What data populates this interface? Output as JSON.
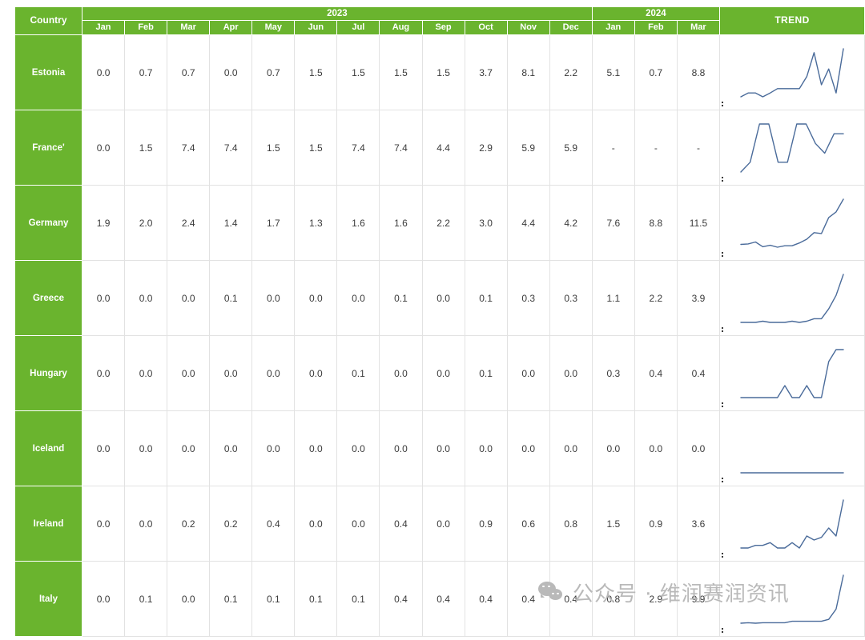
{
  "header": {
    "country_label": "Country",
    "trend_label": "TREND",
    "year_groups": [
      {
        "year": "2023",
        "months": [
          "Jan",
          "Feb",
          "Mar",
          "Apr",
          "May",
          "Jun",
          "Jul",
          "Aug",
          "Sep",
          "Oct",
          "Nov",
          "Dec"
        ]
      },
      {
        "year": "2024",
        "months": [
          "Jan",
          "Feb",
          "Mar"
        ]
      }
    ]
  },
  "colors": {
    "header_green": "#6ab42e",
    "grid_line": "#e2e2e2",
    "spark_line": "#4a6b9a",
    "value_text": "#3b3b3b",
    "watermark": "#b9b9b9"
  },
  "watermark": {
    "text": "公众号 · 维润赛润资讯",
    "logo": "wechat-logo"
  },
  "rows": [
    {
      "country": "Estonia",
      "values": [
        "0.0",
        "0.7",
        "0.7",
        "0.0",
        "0.7",
        "1.5",
        "1.5",
        "1.5",
        "1.5",
        "3.7",
        "8.1",
        "2.2",
        "5.1",
        "0.7",
        "8.8"
      ]
    },
    {
      "country": "France'",
      "values": [
        "0.0",
        "1.5",
        "7.4",
        "7.4",
        "1.5",
        "1.5",
        "7.4",
        "7.4",
        "4.4",
        "2.9",
        "5.9",
        "5.9",
        "-",
        "-",
        "-"
      ]
    },
    {
      "country": "Germany",
      "values": [
        "1.9",
        "2.0",
        "2.4",
        "1.4",
        "1.7",
        "1.3",
        "1.6",
        "1.6",
        "2.2",
        "3.0",
        "4.4",
        "4.2",
        "7.6",
        "8.8",
        "11.5"
      ]
    },
    {
      "country": "Greece",
      "values": [
        "0.0",
        "0.0",
        "0.0",
        "0.1",
        "0.0",
        "0.0",
        "0.0",
        "0.1",
        "0.0",
        "0.1",
        "0.3",
        "0.3",
        "1.1",
        "2.2",
        "3.9"
      ]
    },
    {
      "country": "Hungary",
      "values": [
        "0.0",
        "0.0",
        "0.0",
        "0.0",
        "0.0",
        "0.0",
        "0.1",
        "0.0",
        "0.0",
        "0.1",
        "0.0",
        "0.0",
        "0.3",
        "0.4",
        "0.4"
      ]
    },
    {
      "country": "Iceland",
      "values": [
        "0.0",
        "0.0",
        "0.0",
        "0.0",
        "0.0",
        "0.0",
        "0.0",
        "0.0",
        "0.0",
        "0.0",
        "0.0",
        "0.0",
        "0.0",
        "0.0",
        "0.0"
      ]
    },
    {
      "country": "Ireland",
      "values": [
        "0.0",
        "0.0",
        "0.2",
        "0.2",
        "0.4",
        "0.0",
        "0.0",
        "0.4",
        "0.0",
        "0.9",
        "0.6",
        "0.8",
        "1.5",
        "0.9",
        "3.6"
      ]
    },
    {
      "country": "Italy",
      "values": [
        "0.0",
        "0.1",
        "0.0",
        "0.1",
        "0.1",
        "0.1",
        "0.1",
        "0.4",
        "0.4",
        "0.4",
        "0.4",
        "0.4",
        "0.8",
        "2.9",
        "9.9"
      ]
    }
  ],
  "chart_data": {
    "type": "line",
    "title": "",
    "xlabel": "",
    "ylabel": "",
    "categories": [
      "2023 Jan",
      "2023 Feb",
      "2023 Mar",
      "2023 Apr",
      "2023 May",
      "2023 Jun",
      "2023 Jul",
      "2023 Aug",
      "2023 Sep",
      "2023 Oct",
      "2023 Nov",
      "2023 Dec",
      "2024 Jan",
      "2024 Feb",
      "2024 Mar"
    ],
    "series": [
      {
        "name": "Estonia",
        "values": [
          0.0,
          0.7,
          0.7,
          0.0,
          0.7,
          1.5,
          1.5,
          1.5,
          1.5,
          3.7,
          8.1,
          2.2,
          5.1,
          0.7,
          8.8
        ]
      },
      {
        "name": "France'",
        "values": [
          0.0,
          1.5,
          7.4,
          7.4,
          1.5,
          1.5,
          7.4,
          7.4,
          4.4,
          2.9,
          5.9,
          5.9,
          null,
          null,
          null
        ]
      },
      {
        "name": "Germany",
        "values": [
          1.9,
          2.0,
          2.4,
          1.4,
          1.7,
          1.3,
          1.6,
          1.6,
          2.2,
          3.0,
          4.4,
          4.2,
          7.6,
          8.8,
          11.5
        ]
      },
      {
        "name": "Greece",
        "values": [
          0.0,
          0.0,
          0.0,
          0.1,
          0.0,
          0.0,
          0.0,
          0.1,
          0.0,
          0.1,
          0.3,
          0.3,
          1.1,
          2.2,
          3.9
        ]
      },
      {
        "name": "Hungary",
        "values": [
          0.0,
          0.0,
          0.0,
          0.0,
          0.0,
          0.0,
          0.1,
          0.0,
          0.0,
          0.1,
          0.0,
          0.0,
          0.3,
          0.4,
          0.4
        ]
      },
      {
        "name": "Iceland",
        "values": [
          0.0,
          0.0,
          0.0,
          0.0,
          0.0,
          0.0,
          0.0,
          0.0,
          0.0,
          0.0,
          0.0,
          0.0,
          0.0,
          0.0,
          0.0
        ]
      },
      {
        "name": "Ireland",
        "values": [
          0.0,
          0.0,
          0.2,
          0.2,
          0.4,
          0.0,
          0.0,
          0.4,
          0.0,
          0.9,
          0.6,
          0.8,
          1.5,
          0.9,
          3.6
        ]
      },
      {
        "name": "Italy",
        "values": [
          0.0,
          0.1,
          0.0,
          0.1,
          0.1,
          0.1,
          0.1,
          0.4,
          0.4,
          0.4,
          0.4,
          0.4,
          0.8,
          2.9,
          9.9
        ]
      }
    ],
    "legend": "row-labels",
    "grid": false
  }
}
